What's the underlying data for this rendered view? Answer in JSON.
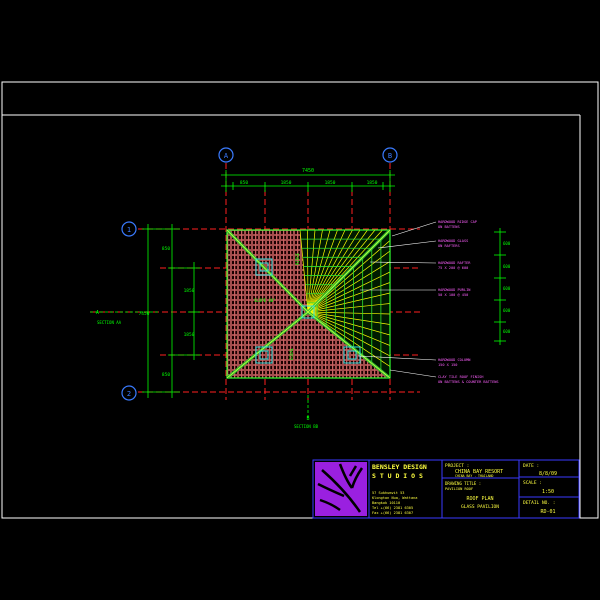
{
  "colors": {
    "background": "#000000",
    "frame": "#ffffff",
    "dimension": "#00ff00",
    "grid_line": "#ff2020",
    "grid_bubble": "#3a7bff",
    "tile": "#ff8080",
    "ridge": "#30c030",
    "glass": "#ffff00",
    "callout_text": "#ff60ff",
    "logo_bg": "#9a20e0",
    "title_border": "#3a3aff",
    "title_text": "#ffff40"
  },
  "grid_bubbles": {
    "top_left": "A",
    "top_right": "B",
    "side_top": "1",
    "side_bottom": "2"
  },
  "dimensions": {
    "overall_top": "7450",
    "segments_top": [
      "850",
      "1850",
      "1850",
      "1850",
      "850"
    ],
    "overall_left": "7450",
    "segments_left": [
      "850",
      "1850",
      "1850",
      "850"
    ],
    "inner_left": [
      "1850",
      "1850"
    ]
  },
  "section_marks": {
    "left_label": "A",
    "left_ref": "SECTION AA",
    "bottom_label": "B",
    "bottom_ref": "SECTION BB"
  },
  "plan_labels": {
    "apex": "RIDGE",
    "center_note": "SLOPE 40°",
    "vertical_note": "EQUAL"
  },
  "callouts": [
    {
      "line1": "HARDWOOD RIDGE CAP",
      "line2": "ON BATTENS"
    },
    {
      "line1": "HARDWOOD GLASS",
      "line2": "ON RAFTERS"
    },
    {
      "line1": "HARDWOOD RAFTER",
      "line2": "75 X 200 @ 600"
    },
    {
      "line1": "HARDWOOD PURLIN",
      "line2": "50 X 100 @ 450"
    },
    {
      "line1": "HARDWOOD COLUMN",
      "line2": "150 X 150"
    },
    {
      "line1": "CLAY TILE ROOF FINISH",
      "line2": "ON BATTENS & COUNTER BATTENS"
    }
  ],
  "right_dims": [
    "600",
    "600",
    "600",
    "600",
    "600"
  ],
  "title_block": {
    "firm_name": "BENSLEY DESIGN",
    "firm_sub": "S T U D I O S",
    "address": [
      "57 Sukhumvit 53",
      "Klongton Nua, Wattana",
      "Bangkok 10110",
      "Tel +(66) 2381 6305",
      "Fax +(66) 2381 6307"
    ],
    "project_label": "PROJECT :",
    "project_name": "CHINA BAY RESORT",
    "project_loc": "CHINA BAY . THAILAND",
    "drawing_label": "DRAWING TITLE :",
    "drawing_sub": "PAVILION ROOF",
    "drawing_title": "ROOF PLAN",
    "drawing_title2": "GLASS PAVILION",
    "date_label": "DATE :",
    "date_value": "8/8/09",
    "scale_label": "SCALE :",
    "scale_value": "1:50",
    "detail_label": "DETAIL NO. :",
    "detail_value": "RD-01"
  }
}
